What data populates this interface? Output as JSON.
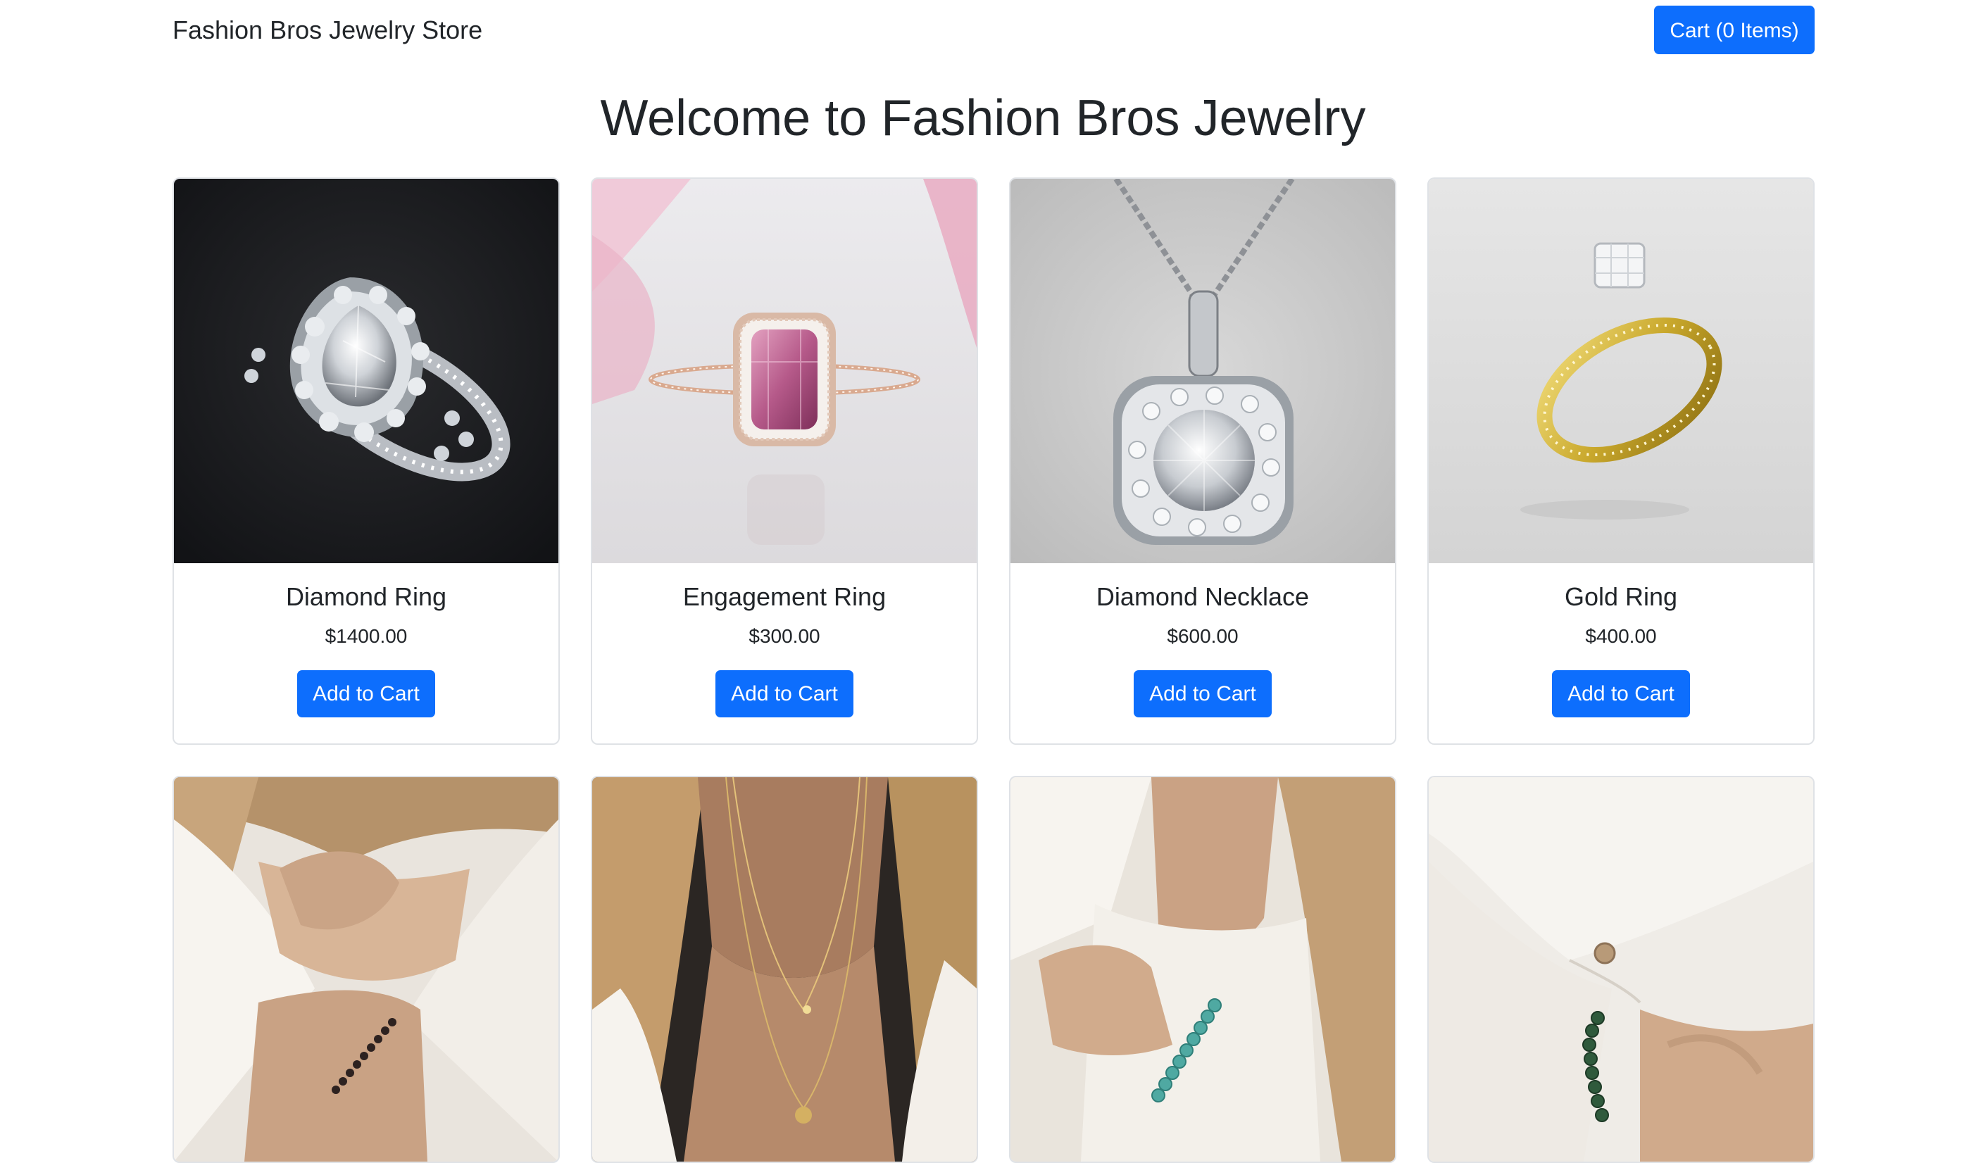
{
  "navbar": {
    "brand": "Fashion Bros Jewelry Store",
    "cart_label": "Cart (0 Items)"
  },
  "page_title": "Welcome to Fashion Bros Jewelry",
  "colors": {
    "primary": "#0d6efd",
    "text": "#212529",
    "card_border": "#dfe2e6"
  },
  "products": [
    {
      "name": "Diamond Ring",
      "price": "$1400.00",
      "button": "Add to Cart",
      "image": "diamond-ring-photo"
    },
    {
      "name": "Engagement Ring",
      "price": "$300.00",
      "button": "Add to Cart",
      "image": "engagement-ring-photo"
    },
    {
      "name": "Diamond Necklace",
      "price": "$600.00",
      "button": "Add to Cart",
      "image": "diamond-necklace-photo"
    },
    {
      "name": "Gold Ring",
      "price": "$400.00",
      "button": "Add to Cart",
      "image": "gold-ring-photo"
    },
    {
      "image": "beaded-bracelet-photo"
    },
    {
      "image": "layered-necklace-photo"
    },
    {
      "image": "turquoise-bracelet-photo"
    },
    {
      "image": "green-bead-bracelet-photo"
    }
  ]
}
